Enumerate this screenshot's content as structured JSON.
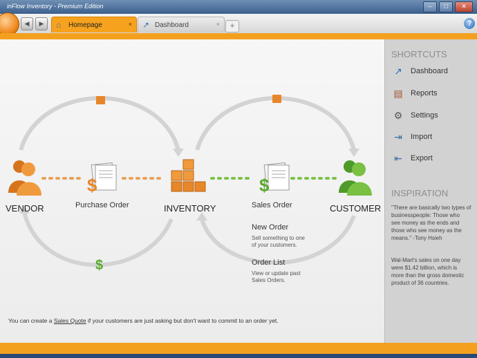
{
  "window": {
    "title": "inFlow Inventory - Premium Edition",
    "btn_min": "–",
    "btn_max": "□",
    "btn_close": "✕"
  },
  "tabs": [
    {
      "label": "Homepage",
      "close": "×"
    },
    {
      "label": "Dashboard",
      "close": "×"
    }
  ],
  "nav": {
    "back": "◀",
    "forward": "▶",
    "new_tab": "+",
    "help": "?"
  },
  "diagram": {
    "vendor": "VENDOR",
    "purchase_order": "Purchase Order",
    "inventory": "INVENTORY",
    "sales_order": "Sales Order",
    "customer": "CUSTOMER",
    "new_order": {
      "title": "New Order",
      "desc_line1": "Sell something to one",
      "desc_line2": "of your customers."
    },
    "order_list": {
      "title": "Order List",
      "desc_line1": "View or update past",
      "desc_line2": "Sales Orders."
    },
    "dollar": "$"
  },
  "footer": {
    "pre": "You can create a ",
    "link": "Sales Quote",
    "post": " if your customers are just asking but don't want to commit to an order yet."
  },
  "sidebar": {
    "shortcuts_title": "SHORTCUTS",
    "items": [
      {
        "label": "Dashboard",
        "icon": "dashboard-icon"
      },
      {
        "label": "Reports",
        "icon": "reports-icon"
      },
      {
        "label": "Settings",
        "icon": "settings-gear-icon"
      },
      {
        "label": "Import",
        "icon": "import-icon"
      },
      {
        "label": "Export",
        "icon": "export-icon"
      }
    ],
    "inspiration_title": "INSPIRATION",
    "quote": [
      "\"There are basically two types of",
      "businesspeople: Those who",
      "see money as the ends and",
      "those who see money as the",
      "means.\" -Tony Hsieh"
    ],
    "fact": [
      "Wal-Mart's sales on one day",
      "were $1.42 billion, which is",
      "more than the gross domestic",
      "product of 36 countries."
    ]
  },
  "colors": {
    "accent": "#f4a01f",
    "vendor": "#e8862a",
    "customer": "#6fb83a"
  }
}
